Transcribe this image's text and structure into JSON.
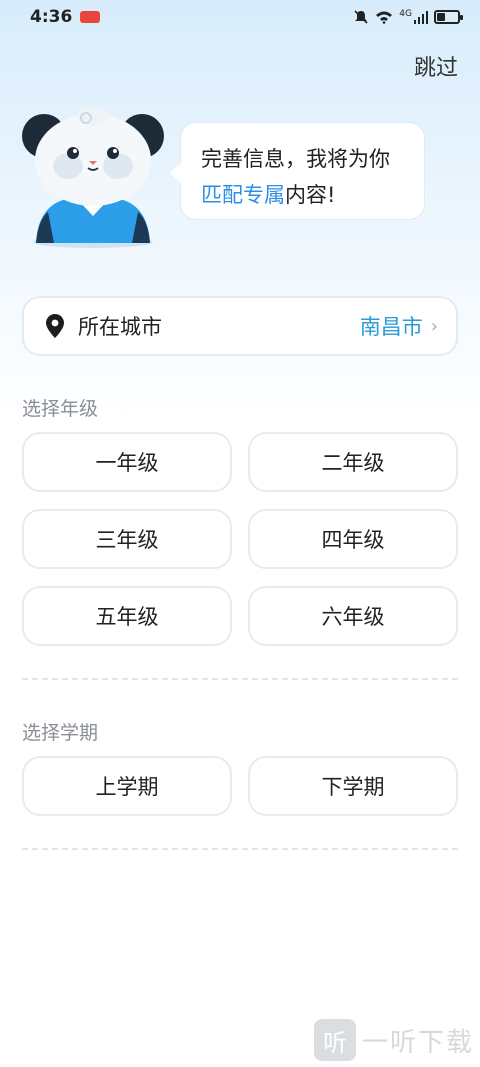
{
  "status_bar": {
    "time": "4:36",
    "network": "4G"
  },
  "header": {
    "skip_label": "跳过"
  },
  "bubble": {
    "line1": "完善信息，我将为你",
    "highlight": "匹配专属",
    "line2_rest": "内容!"
  },
  "city": {
    "label": "所在城市",
    "value": "南昌市",
    "chevron": "›"
  },
  "grade_section": {
    "title": "选择年级",
    "options": [
      "一年级",
      "二年级",
      "三年级",
      "四年级",
      "五年级",
      "六年级"
    ]
  },
  "term_section": {
    "title": "选择学期",
    "options": [
      "上学期",
      "下学期"
    ]
  },
  "watermark": {
    "glyph": "听",
    "text": "一听下载"
  },
  "colors": {
    "accent": "#2a8fe6",
    "city_value": "#2a9bd8",
    "border": "#e8ebee"
  }
}
